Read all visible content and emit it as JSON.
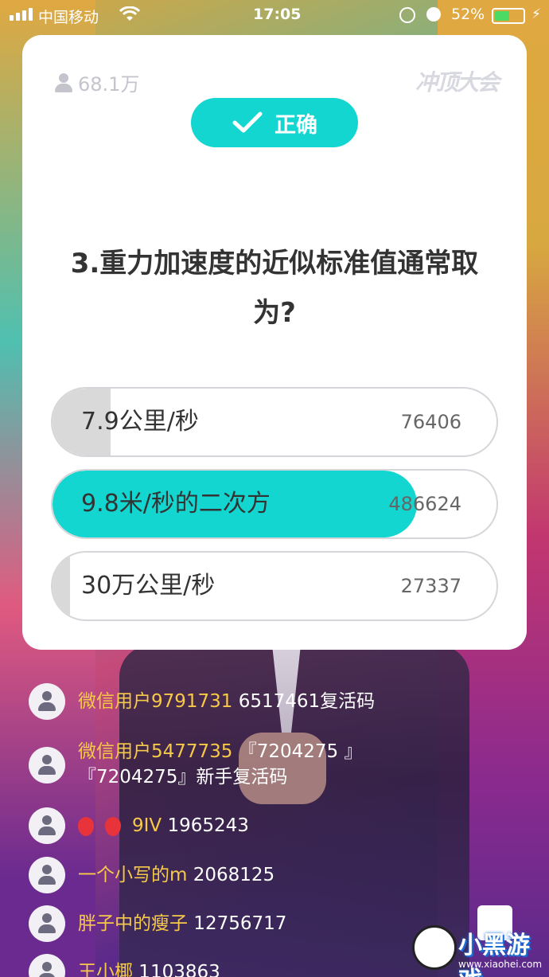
{
  "status_bar": {
    "carrier": "中国移动",
    "time": "17:05",
    "battery_percent": "52%",
    "battery_level": 0.52
  },
  "card": {
    "viewer_count": "68.1万",
    "brand": "冲顶大会",
    "result_label": "正确",
    "question": "3.重力加速度的近似标准值通常取为?",
    "options": [
      {
        "label": "7.9公里/秒",
        "count": "76406",
        "fill_fraction": 0.13,
        "correct": false
      },
      {
        "label": "9.8米/秒的二次方",
        "count": "486624",
        "fill_fraction": 0.82,
        "correct": true
      },
      {
        "label": "30万公里/秒",
        "count": "27337",
        "fill_fraction": 0.04,
        "correct": false
      }
    ]
  },
  "comments": [
    {
      "user": "微信用户9791731",
      "text": " 6517461复活码"
    },
    {
      "user": "微信用户5477735",
      "text": " 『7204275 』『7204275』新手复活码"
    },
    {
      "user": "9IV",
      "text": " 1965243"
    },
    {
      "user": "一个小写的m",
      "text": " 2068125"
    },
    {
      "user": "胖子中的瘦子",
      "text": " 12756717"
    },
    {
      "user": "王小椰",
      "text": " 1103863"
    }
  ],
  "watermark": {
    "text": "小黑游戏",
    "url": "www.xiaohei.com"
  },
  "colors": {
    "accent": "#12d6cf",
    "username": "#f7c948",
    "option_fill": "#d9d9d9"
  }
}
